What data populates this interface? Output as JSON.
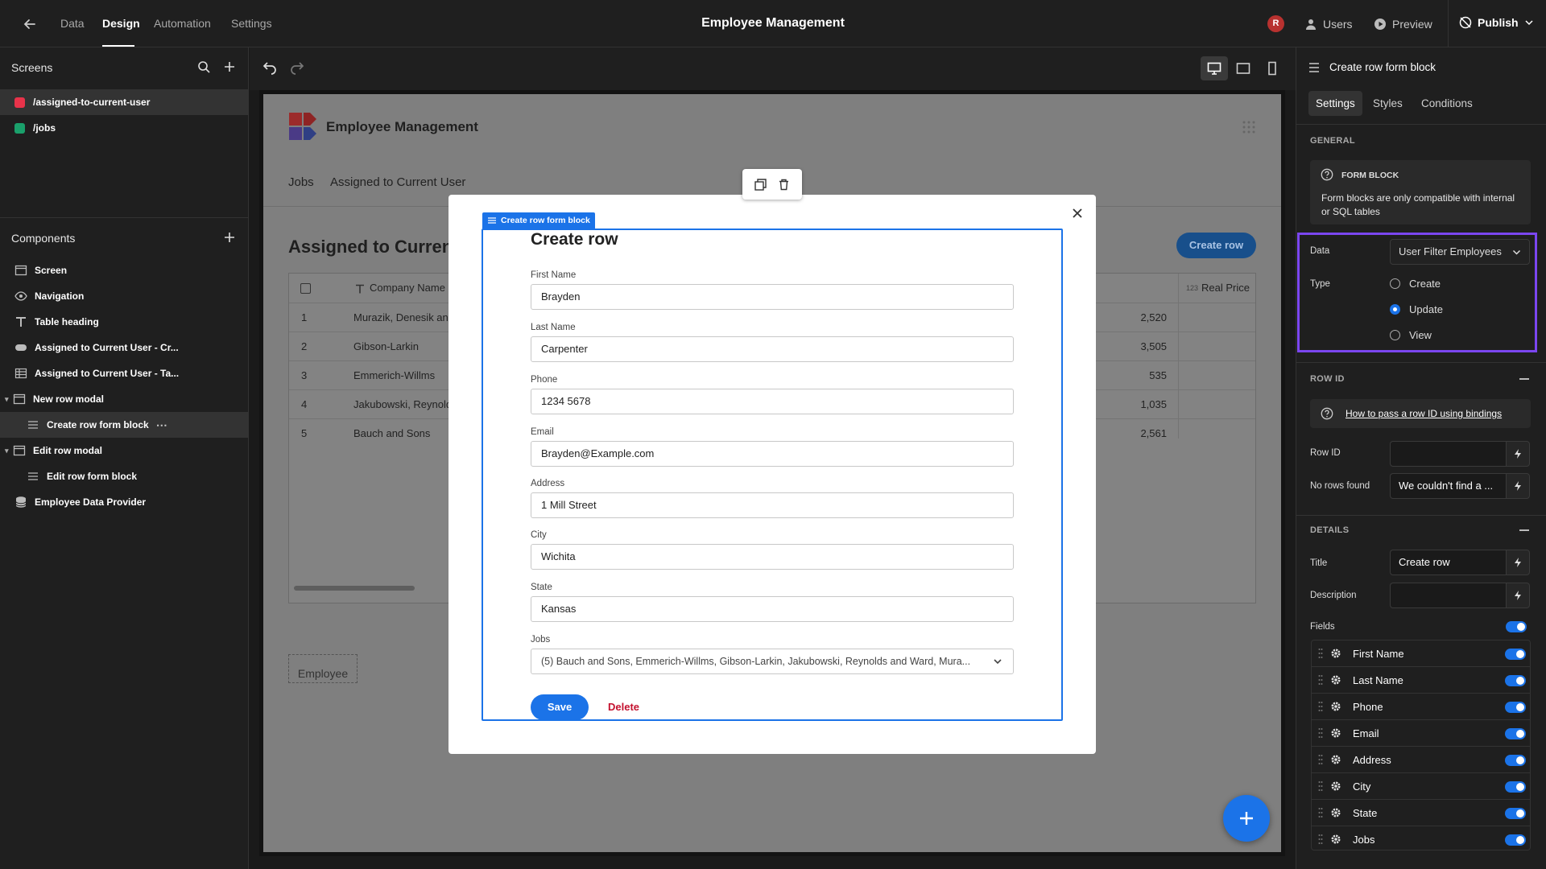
{
  "topbar": {
    "tabs": [
      "Data",
      "Design",
      "Automation",
      "Settings"
    ],
    "active_tab": "Design",
    "app_title": "Employee Management",
    "avatar_initial": "R",
    "users_label": "Users",
    "preview_label": "Preview",
    "publish_label": "Publish"
  },
  "screens": {
    "title": "Screens",
    "items": [
      {
        "path": "/assigned-to-current-user",
        "color": "#e8334a",
        "selected": true
      },
      {
        "path": "/jobs",
        "color": "#1aa06b",
        "selected": false
      }
    ]
  },
  "components": {
    "title": "Components",
    "items": [
      {
        "label": "Screen",
        "icon": "screen-icon"
      },
      {
        "label": "Navigation",
        "icon": "eye-icon"
      },
      {
        "label": "Table heading",
        "icon": "text-icon"
      },
      {
        "label": "Assigned to Current User - Cr...",
        "icon": "button-icon"
      },
      {
        "label": "Assigned to Current User - Ta...",
        "icon": "table-icon"
      },
      {
        "label": "New row modal",
        "icon": "modal-icon",
        "expanded": true
      },
      {
        "label": "Create row form block",
        "icon": "form-icon",
        "selected": true
      },
      {
        "label": "Edit row modal",
        "icon": "modal-icon",
        "expanded": true
      },
      {
        "label": "Edit row form block",
        "icon": "form-icon"
      },
      {
        "label": "Employee Data Provider",
        "icon": "database-icon"
      }
    ]
  },
  "preview": {
    "app_title": "Employee Management",
    "nav_links": [
      "Jobs",
      "Assigned to Current User"
    ],
    "heading": "Assigned to Current U",
    "create_button": "Create row",
    "table": {
      "col_company": "Company Name",
      "col_price_type": "123",
      "col_price": "Real Price",
      "rows": [
        {
          "n": "1",
          "company": "Murazik, Denesik and",
          "value": "2,520"
        },
        {
          "n": "2",
          "company": "Gibson-Larkin",
          "value": "3,505"
        },
        {
          "n": "3",
          "company": "Emmerich-Willms",
          "value": "535"
        },
        {
          "n": "4",
          "company": "Jakubowski, Reynold",
          "value": "1,035"
        },
        {
          "n": "5",
          "company": "Bauch and Sons",
          "value": "2,561"
        }
      ]
    },
    "employee_placeholder": "Employee"
  },
  "form_block": {
    "tag_label": "Create row form block",
    "title": "Create row",
    "fields": [
      {
        "label": "First Name",
        "value": "Brayden"
      },
      {
        "label": "Last Name",
        "value": "Carpenter"
      },
      {
        "label": "Phone",
        "value": "1234 5678"
      },
      {
        "label": "Email",
        "value": "Brayden@Example.com"
      },
      {
        "label": "Address",
        "value": "1 Mill Street"
      },
      {
        "label": "City",
        "value": "Wichita"
      },
      {
        "label": "State",
        "value": "Kansas"
      }
    ],
    "jobs_label": "Jobs",
    "jobs_value": "(5) Bauch and Sons, Emmerich-Willms, Gibson-Larkin, Jakubowski, Reynolds and Ward, Mura...",
    "save_label": "Save",
    "delete_label": "Delete"
  },
  "settings_panel": {
    "header": "Create row form block",
    "tabs": [
      "Settings",
      "Styles",
      "Conditions"
    ],
    "active_tab": "Settings",
    "general_label": "GENERAL",
    "info_title": "FORM BLOCK",
    "info_text": "Form blocks are only compatible with internal or SQL tables",
    "data_label": "Data",
    "data_value": "User Filter Employees",
    "type_label": "Type",
    "type_options": [
      "Create",
      "Update",
      "View"
    ],
    "type_selected": "Update",
    "row_id_section": "ROW ID",
    "row_id_help": "How to pass a row ID using bindings",
    "row_id_label": "Row ID",
    "row_id_value": "",
    "no_rows_label": "No rows found",
    "no_rows_value": "We couldn't find a ...",
    "details_section": "DETAILS",
    "title_label": "Title",
    "title_value": "Create row",
    "description_label": "Description",
    "description_value": "",
    "fields_label": "Fields",
    "field_items": [
      "First Name",
      "Last Name",
      "Phone",
      "Email",
      "Address",
      "City",
      "State",
      "Jobs"
    ]
  }
}
